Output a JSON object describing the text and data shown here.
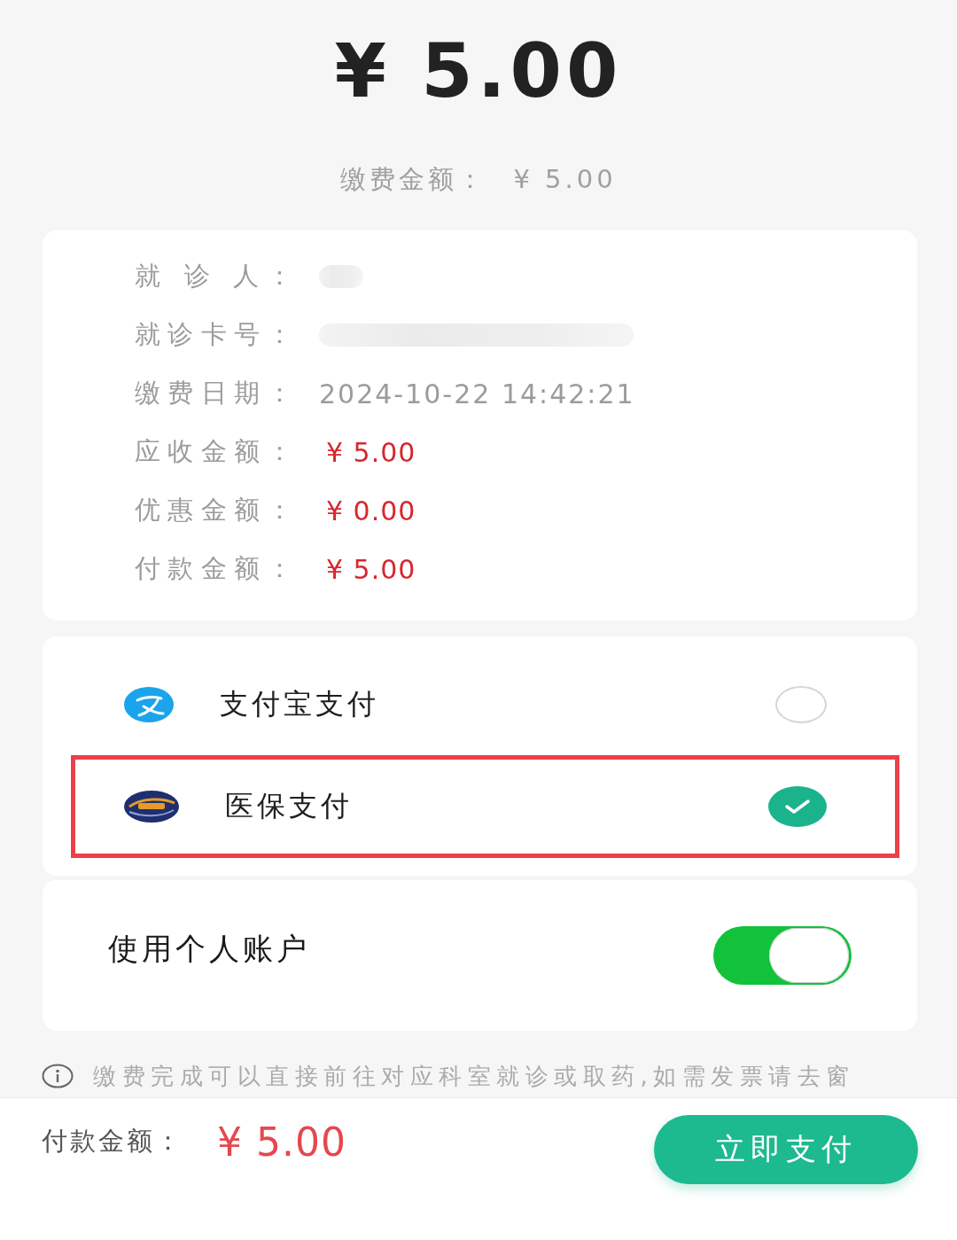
{
  "header": {
    "amount": "¥ 5.00",
    "subtitle_label": "缴费金额：",
    "subtitle_amount": "¥ 5.00"
  },
  "details": [
    {
      "label": "就 诊 人：",
      "kind": "shortmask"
    },
    {
      "label": "就诊卡号：",
      "kind": "longmask"
    },
    {
      "label": "缴费日期：",
      "kind": "text",
      "value": "2024-10-22 14:42:21"
    },
    {
      "label": "应收金额：",
      "kind": "amount",
      "value": "¥ 5.00"
    },
    {
      "label": "优惠金额：",
      "kind": "amount",
      "value": "¥ 0.00"
    },
    {
      "label": "付款金额：",
      "kind": "amount",
      "value": "¥ 5.00"
    }
  ],
  "payment_methods": [
    {
      "label": "支付宝支付",
      "kind": "alipay",
      "selected": false,
      "highlighted": false
    },
    {
      "label": "医保支付",
      "kind": "insurance",
      "selected": true,
      "highlighted": true
    }
  ],
  "personal_account": {
    "label": "使用个人账户",
    "on": true
  },
  "notice": "缴费完成可以直接前往对应科室就诊或取药,如需发票请去窗",
  "footer": {
    "label": "付款金额：",
    "amount": "¥ 5.00",
    "button": "立即支付"
  }
}
